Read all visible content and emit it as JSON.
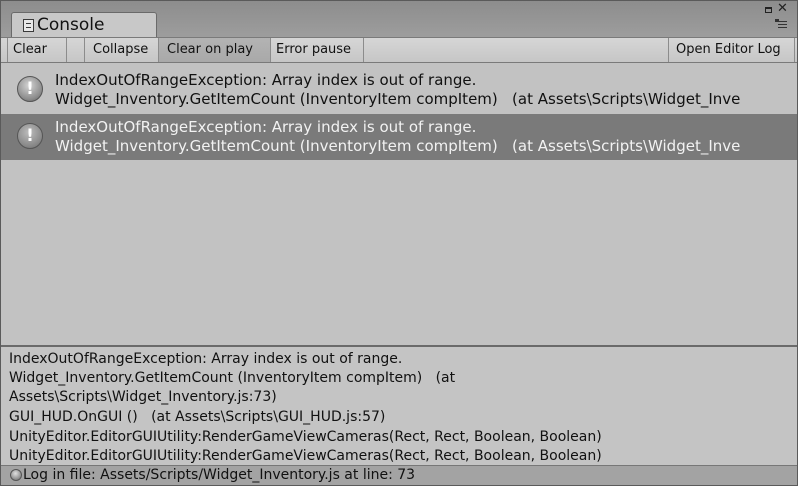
{
  "window": {
    "tab_title": "Console",
    "tab_icon": "console-list-icon"
  },
  "toolbar": {
    "clear": "Clear",
    "collapse": "Collapse",
    "clear_on_play": "Clear on play",
    "error_pause": "Error pause",
    "open_editor_log": "Open Editor Log",
    "clear_on_play_active": true
  },
  "entries": [
    {
      "icon": "error-icon",
      "line1": "IndexOutOfRangeException: Array index is out of range.",
      "line2": "Widget_Inventory.GetItemCount (InventoryItem compItem)   (at Assets\\Scripts\\Widget_Inve",
      "selected": false
    },
    {
      "icon": "error-icon",
      "line1": "IndexOutOfRangeException: Array index is out of range.",
      "line2": "Widget_Inventory.GetItemCount (InventoryItem compItem)   (at Assets\\Scripts\\Widget_Inve",
      "selected": true
    }
  ],
  "detail": {
    "lines": [
      "IndexOutOfRangeException: Array index is out of range.",
      "Widget_Inventory.GetItemCount (InventoryItem compItem)   (at",
      "Assets\\Scripts\\Widget_Inventory.js:73)",
      "GUI_HUD.OnGUI ()   (at Assets\\Scripts\\GUI_HUD.js:57)",
      "UnityEditor.EditorGUIUtility:RenderGameViewCameras(Rect, Rect, Boolean, Boolean)",
      "UnityEditor.EditorGUIUtility:RenderGameViewCameras(Rect, Rect, Boolean, Boolean)"
    ]
  },
  "status": {
    "text": "Log in file: Assets/Scripts/Widget_Inventory.js at line: 73"
  }
}
